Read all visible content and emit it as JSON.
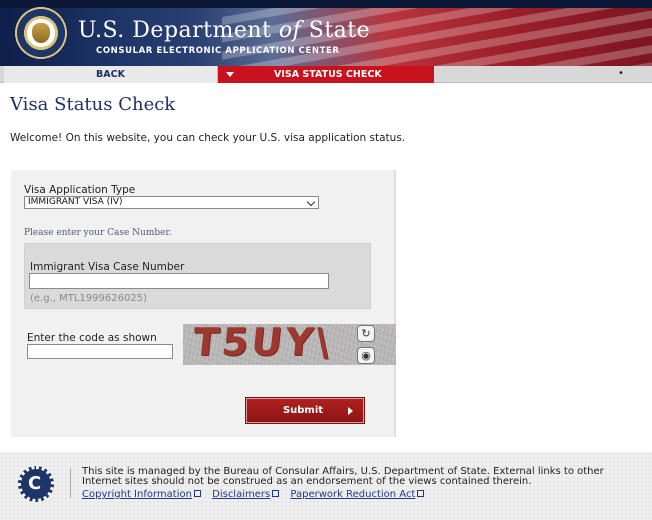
{
  "header": {
    "title_prefix": "U.S. Department ",
    "title_of": "of",
    "title_suffix": " State",
    "subtitle": "CONSULAR ELECTRONIC APPLICATION CENTER"
  },
  "nav": {
    "back_label": "BACK",
    "active_label": "VISA STATUS CHECK",
    "extra": "•"
  },
  "page": {
    "title": "Visa Status Check",
    "welcome": "Welcome! On this website, you can check your U.S. visa application status."
  },
  "form": {
    "visa_type_label": "Visa Application Type",
    "visa_type_value": "IMMIGRANT VISA (IV)",
    "case_hint": "Please enter your Case Number.",
    "case_label": "Immigrant Visa Case Number",
    "case_value": "",
    "case_example": "(e.g., MTL1999626025)",
    "code_label": "Enter the code as shown",
    "code_value": "",
    "captcha_text": "T5UY\\",
    "submit_label": "Submit"
  },
  "footer": {
    "text": "This site is managed by the Bureau of Consular Affairs, U.S. Department of State. External links to other Internet sites should not be construed as an endorsement of the views contained therein.",
    "links": [
      "Copyright Information",
      "Disclaimers",
      "Paperwork Reduction Act"
    ]
  },
  "icons": {
    "seal": "department-seal-icon",
    "refresh": "refresh-icon",
    "audio": "audio-icon",
    "external": "external-link-icon",
    "footer_logo": "consular-affairs-logo"
  },
  "colors": {
    "accent": "#c8121d",
    "navy": "#1d2f63"
  }
}
